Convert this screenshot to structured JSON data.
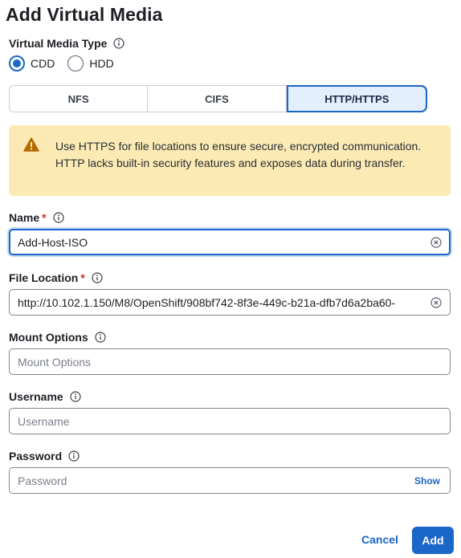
{
  "dialog": {
    "title": "Add Virtual Media"
  },
  "media_type": {
    "label": "Virtual Media Type",
    "options": [
      {
        "label": "CDD",
        "checked": true
      },
      {
        "label": "HDD",
        "checked": false
      }
    ]
  },
  "protocol_tabs": {
    "items": [
      {
        "label": "NFS",
        "active": false
      },
      {
        "label": "CIFS",
        "active": false
      },
      {
        "label": "HTTP/HTTPS",
        "active": true
      }
    ]
  },
  "alert": {
    "icon": "warning-icon",
    "text": "Use HTTPS for file locations to ensure secure, encrypted communication. HTTP lacks built-in security features and exposes data during transfer.",
    "color": "#fbeab4"
  },
  "fields": {
    "name": {
      "label": "Name",
      "required": true,
      "value": "Add-Host-ISO"
    },
    "file_location": {
      "label": "File Location",
      "required": true,
      "value": "http://10.102.1.150/M8/OpenShift/908bf742-8f3e-449c-b21a-dfb7d6a2ba60-"
    },
    "mount_options": {
      "label": "Mount Options",
      "placeholder": "Mount Options"
    },
    "username": {
      "label": "Username",
      "placeholder": "Username"
    },
    "password": {
      "label": "Password",
      "placeholder": "Password",
      "show_label": "Show"
    }
  },
  "required_marker": "*",
  "footer": {
    "cancel_label": "Cancel",
    "add_label": "Add"
  },
  "colors": {
    "accent": "#1b66c9",
    "required": "#d62b2b"
  }
}
